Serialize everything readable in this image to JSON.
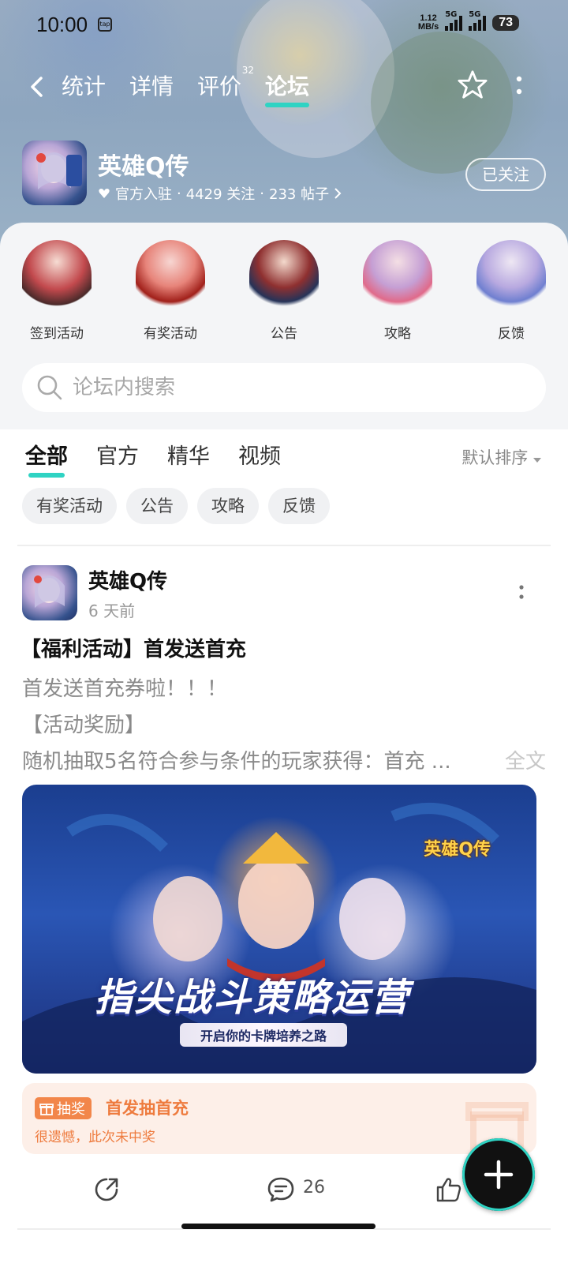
{
  "status_bar": {
    "time": "10:00",
    "app_indicator": "tap",
    "net_speed": "1.12",
    "net_unit": "MB/s",
    "signal1_label": "5G",
    "signal2_label": "5G",
    "battery": "73"
  },
  "nav": {
    "tabs": [
      {
        "label": "统计"
      },
      {
        "label": "详情"
      },
      {
        "label": "评价",
        "badge": "32"
      },
      {
        "label": "论坛"
      }
    ],
    "active_tab": "论坛"
  },
  "game": {
    "name": "英雄Q传",
    "official": "官方入驻",
    "followers": "4429 关注",
    "posts": "233 帖子",
    "follow_button": "已关注"
  },
  "shortcuts": [
    {
      "label": "签到活动"
    },
    {
      "label": "有奖活动"
    },
    {
      "label": "公告"
    },
    {
      "label": "攻略"
    },
    {
      "label": "反馈"
    }
  ],
  "search": {
    "placeholder": "论坛内搜索"
  },
  "filter_tabs": [
    {
      "label": "全部"
    },
    {
      "label": "官方"
    },
    {
      "label": "精华"
    },
    {
      "label": "视频"
    }
  ],
  "active_filter": "全部",
  "sort": {
    "label": "默认排序"
  },
  "chips": [
    {
      "label": "有奖活动"
    },
    {
      "label": "公告"
    },
    {
      "label": "攻略"
    },
    {
      "label": "反馈"
    }
  ],
  "post": {
    "author": "英雄Q传",
    "time": "6 天前",
    "title": "【福利活动】首发送首充",
    "lines": [
      "首发送首充券啦！！！",
      "【活动奖励】",
      "随机抽取5名符合参与条件的玩家获得：首充 ..."
    ],
    "full_text": "全文",
    "image": {
      "logo": "英雄Q传",
      "headline": "指尖战斗策略运营",
      "subline": "开启你的卡牌培养之路"
    },
    "lottery": {
      "tag": "抽奖",
      "title": "首发抽首充",
      "result": "很遗憾，此次未中奖"
    },
    "comment_count": "26"
  },
  "colors": {
    "accent": "#2fd3c3",
    "lottery_orange": "#ee7b3e",
    "lottery_bg": "#fdefe8"
  }
}
